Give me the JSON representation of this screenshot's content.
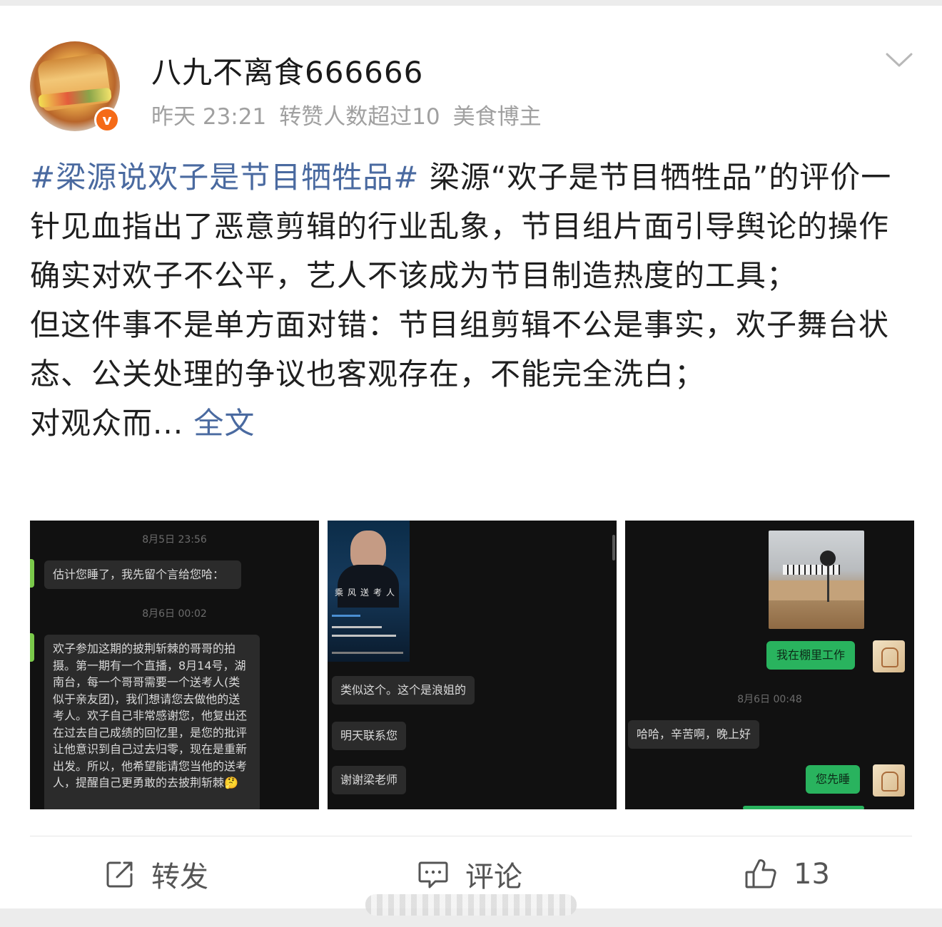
{
  "post": {
    "username": "八九不离食666666",
    "time": "昨天 23:21",
    "repost_badge": "转赞人数超过10",
    "tag": "美食博主",
    "verified_mark": "v",
    "topic": "#梁源说欢子是节目牺牲品#",
    "body": " 梁源“欢子是节目牺牲品”的评价一针见血指出了恶意剪辑的行业乱象，节目组片面引导舆论的操作确实对欢子不公平，艺人不该成为节目制造热度的工具；\n但这件事不是单方面对错：节目组剪辑不公是事实，欢子舞台状态、公关处理的争议也客观存在，不能完全洗白；\n对观众而...",
    "full_text_link": "全文"
  },
  "images": {
    "img1": {
      "ts1": "8月5日 23:56",
      "msg1": "估计您睡了，我先留个言给您哈：",
      "ts2": "8月6日 00:02",
      "msg2": "欢子参加这期的披荆斩棘的哥哥的拍摄。第一期有一个直播，8月14号，湖南台，每一个哥哥需要一个送考人(类似于亲友团)，我们想请您去做他的送考人。欢子自己非常感谢您，他复出还在过去自己成绩的回忆里，是您的批评让他意识到自己过去归零，现在是重新出发。所以，他希望能请您当他的送考人，提醒自己更勇敢的去披荆斩棘🤔"
    },
    "img2": {
      "poster_title": "乘风送考人",
      "msg1": "类似这个。这个是浪姐的",
      "msg2": "明天联系您",
      "msg3": "谢谢梁老师"
    },
    "img3": {
      "msg1": "我在棚里工作",
      "ts1": "8月6日 00:48",
      "msg2": "哈哈，辛苦啊，晚上好",
      "msg3": "您先睡"
    }
  },
  "actions": {
    "repost_label": "转发",
    "comment_label": "评论",
    "like_count": "13"
  },
  "icons": [
    "chevron-down-icon",
    "verified-icon",
    "repost-icon",
    "comment-icon",
    "like-icon"
  ]
}
